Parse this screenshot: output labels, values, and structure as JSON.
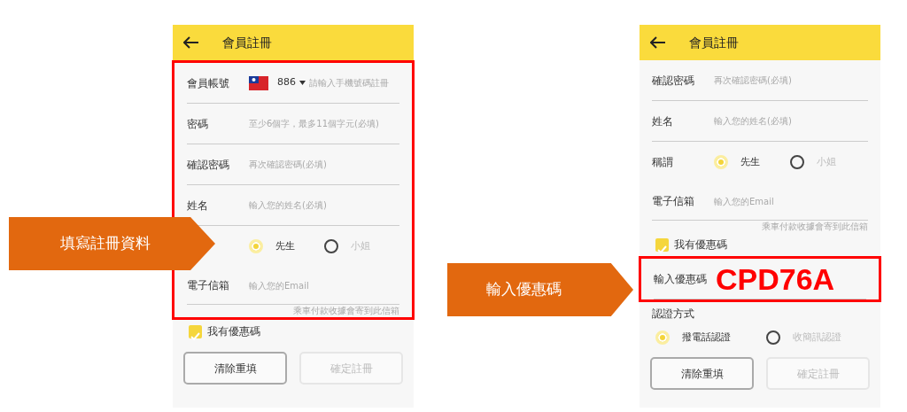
{
  "annotations": [
    {
      "text": "填寫註冊資料"
    },
    {
      "text": "輸入優惠碼"
    }
  ],
  "screens": [
    {
      "title": "會員註冊",
      "sections": [
        {
          "kind": "highlighted",
          "fields": [
            {
              "kind": "phone",
              "label": "會員帳號",
              "country_code": "886",
              "placeholder": "請輸入手機號碼註冊"
            },
            {
              "kind": "text",
              "label": "密碼",
              "placeholder": "至少6個字，最多11個字元(必填)"
            },
            {
              "kind": "text",
              "label": "確認密碼",
              "placeholder": "再次確認密碼(必填)"
            },
            {
              "kind": "text",
              "label": "姓名",
              "placeholder": "輸入您的姓名(必填)"
            },
            {
              "kind": "radio",
              "options": [
                {
                  "label": "先生",
                  "selected": true
                },
                {
                  "label": "小姐",
                  "selected": false
                }
              ]
            },
            {
              "kind": "text",
              "label": "電子信箱",
              "placeholder": "輸入您的Email",
              "hint": "乘車付款收據會寄到此信箱"
            }
          ]
        },
        {
          "kind": "plain",
          "fields": [
            {
              "kind": "checkbox",
              "label": "我有優惠碼",
              "checked": true
            }
          ]
        }
      ],
      "buttons": [
        {
          "label": "清除重填",
          "disabled": false
        },
        {
          "label": "確定註冊",
          "disabled": true
        }
      ]
    },
    {
      "title": "會員註冊",
      "sections": [
        {
          "kind": "plain",
          "fields": [
            {
              "kind": "text",
              "label": "確認密碼",
              "placeholder": "再次確認密碼(必填)"
            },
            {
              "kind": "text",
              "label": "姓名",
              "placeholder": "輸入您的姓名(必填)"
            },
            {
              "kind": "radio",
              "label": "稱謂",
              "options": [
                {
                  "label": "先生",
                  "selected": true
                },
                {
                  "label": "小姐",
                  "selected": false
                }
              ]
            },
            {
              "kind": "text",
              "label": "電子信箱",
              "placeholder": "輸入您的Email",
              "hint": "乘車付款收據會寄到此信箱"
            },
            {
              "kind": "checkbox",
              "label": "我有優惠碼",
              "checked": true
            }
          ]
        },
        {
          "kind": "highlighted",
          "fields": [
            {
              "kind": "text",
              "label": "輸入優惠碼",
              "value": "CPD76A"
            }
          ]
        },
        {
          "kind": "plain",
          "fields": [
            {
              "kind": "radio_block",
              "label": "認證方式",
              "options": [
                {
                  "label": "撥電話認證",
                  "selected": true
                },
                {
                  "label": "收簡訊認證",
                  "selected": false
                }
              ]
            }
          ]
        }
      ],
      "buttons": [
        {
          "label": "清除重填",
          "disabled": false
        },
        {
          "label": "確定註冊",
          "disabled": true
        }
      ]
    }
  ]
}
